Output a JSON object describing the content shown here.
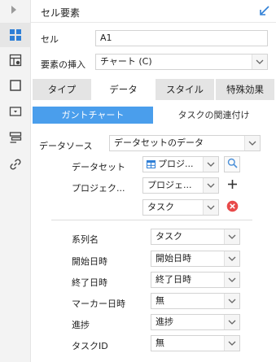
{
  "panel": {
    "title": "セル要素"
  },
  "rail": {
    "icons": [
      "cell-element-icon",
      "data-table-icon",
      "border-icon",
      "dropdown-icon",
      "stack-icon",
      "link-icon"
    ]
  },
  "cell": {
    "label": "セル",
    "value": "A1"
  },
  "insert": {
    "label": "要素の挿入",
    "selected": "チャート (C)"
  },
  "tabs": [
    "タイプ",
    "データ",
    "スタイル",
    "特殊効果"
  ],
  "active_tab": "データ",
  "subtabs": [
    "ガントチャート",
    "タスクの関連付け"
  ],
  "active_subtab": "ガントチャート",
  "datasource": {
    "label": "データソース",
    "selected": "データセットのデータ"
  },
  "dataset": {
    "label": "データセット",
    "selected": "プロジ..."
  },
  "project": {
    "label": "プロジェク...",
    "selected": "プロジェ..."
  },
  "task": {
    "selected": "タスク"
  },
  "fields": [
    {
      "label": "系列名",
      "value": "タスク"
    },
    {
      "label": "開始日時",
      "value": "開始日時"
    },
    {
      "label": "終了日時",
      "value": "終了日時"
    },
    {
      "label": "マーカー日時",
      "value": "無"
    },
    {
      "label": "進捗",
      "value": "進捗"
    },
    {
      "label": "タスクID",
      "value": "無"
    }
  ],
  "colors": {
    "accent": "#4a9eec",
    "remove": "#e84a4a"
  }
}
